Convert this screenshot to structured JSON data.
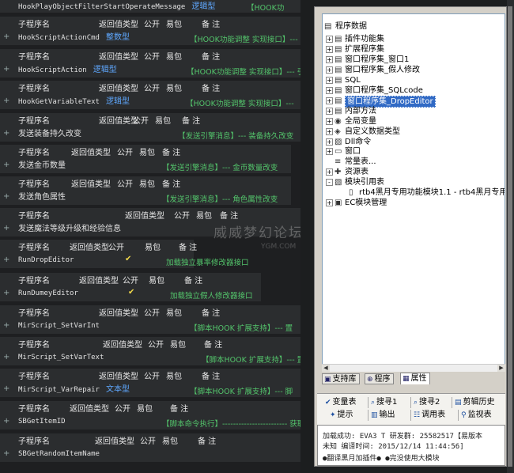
{
  "header_labels": [
    "子程序名",
    "返回值类型",
    "公开",
    "易包",
    "备 注"
  ],
  "top_line": {
    "name": "HookPlayObjectFilterStartOperateMessage",
    "type": "逻辑型",
    "comment": "【HOOK功"
  },
  "cards": [
    {
      "name": "HookScriptActionCmd",
      "type": "整数型",
      "check": "",
      "comment": "【HOOK功能调整 实现接口】---"
    },
    {
      "name": "HookScriptAction",
      "type": "逻辑型",
      "check": "",
      "comment": "【HOOK功能调整 实现接口】--- 引"
    },
    {
      "name": "HookGetVariableText",
      "type": "逻辑型",
      "check": "",
      "comment": "【HOOK功能调整 实现接口】---"
    },
    {
      "name": "发送装备持久改变",
      "type": "",
      "check": "",
      "comment": "【发送引擎消息】--- 装备持久改变"
    },
    {
      "name": "发送金币数量",
      "type": "",
      "check": "",
      "comment": "【发送引擎消息】--- 金币数量改变"
    },
    {
      "name": "发送角色属性",
      "type": "",
      "check": "",
      "comment": "【发送引擎消息】--- 角色属性改变"
    },
    {
      "name": "发送魔法等级升级和经验信息",
      "type": "",
      "check": "",
      "comment": ""
    },
    {
      "name": "RunDropEditor",
      "type": "",
      "check": "✔",
      "comment": "加载独立暴率修改器接口"
    },
    {
      "name": "RunDumeyEditor",
      "type": "",
      "check": "✔",
      "comment": "加载独立假人修改器接口"
    },
    {
      "name": "MirScript_SetVarInt",
      "type": "",
      "check": "",
      "comment": "【脚本HOOK 扩展支持】--- 置"
    },
    {
      "name": "MirScript_SetVarText",
      "type": "",
      "check": "",
      "comment": "【脚本HOOK 扩展支持】--- 置"
    },
    {
      "name": "MirScript_VarRepair",
      "type": "文本型",
      "check": "",
      "comment": "【脚本HOOK 扩展支持】--- 脚"
    },
    {
      "name": "SBGetItemID",
      "type": "",
      "check": "",
      "comment": "【脚本命令执行】------------------------ 获取"
    },
    {
      "name": "SBGetRandomItemName",
      "type": "",
      "check": "",
      "comment": ""
    }
  ],
  "watermark": {
    "main": "威威梦幻论坛",
    "sub": "YGM.COM"
  },
  "tree": {
    "root": "程序数据",
    "items": [
      {
        "label": "插件功能集",
        "icon": "stack-icon",
        "expander": "+"
      },
      {
        "label": "扩展程序集",
        "icon": "stack-icon",
        "expander": "+"
      },
      {
        "label": "窗口程序集_窗口1",
        "icon": "stack-icon",
        "expander": "+"
      },
      {
        "label": "窗口程序集_假人修改",
        "icon": "stack-icon",
        "expander": "+"
      },
      {
        "label": "SQL",
        "icon": "stack-icon",
        "expander": "+"
      },
      {
        "label": "窗口程序集_SQLcode",
        "icon": "stack-icon",
        "expander": "+"
      },
      {
        "label": "窗口程序集_DropEditor",
        "icon": "stack-icon",
        "expander": "+",
        "selected": true
      },
      {
        "label": "内部方法",
        "icon": "stack-icon",
        "expander": "+"
      },
      {
        "label": "全局变量",
        "icon": "globe-icon",
        "expander": "+"
      },
      {
        "label": "自定义数据类型",
        "icon": "type-icon",
        "expander": "+"
      },
      {
        "label": "Dll命令",
        "icon": "dll-icon",
        "expander": "+"
      },
      {
        "label": "窗口",
        "icon": "window-icon",
        "expander": "+"
      },
      {
        "label": "常量表...",
        "icon": "const-icon",
        "expander": ""
      },
      {
        "label": "资源表",
        "icon": "resource-icon",
        "expander": "+"
      },
      {
        "label": "模块引用表",
        "icon": "module-icon",
        "expander": "-"
      },
      {
        "label": "rtb4黑月专用功能模块1.1 - rtb4黑月专用",
        "icon": "module-file-icon",
        "expander": "",
        "child": true
      },
      {
        "label": "EC模块管理",
        "icon": "ec-icon",
        "expander": "+"
      }
    ]
  },
  "bottom_tabs": [
    {
      "label": "支持库",
      "icon": "library-icon"
    },
    {
      "label": "程序",
      "icon": "program-icon"
    },
    {
      "label": "属性",
      "icon": "property-icon",
      "active": true
    }
  ],
  "tools": [
    {
      "label": "变量表",
      "icon": "variable-icon"
    },
    {
      "label": "搜寻1",
      "icon": "search-icon"
    },
    {
      "label": "搜寻2",
      "icon": "search-icon"
    },
    {
      "label": "剪辑历史",
      "icon": "clipboard-icon"
    },
    {
      "label": "提示",
      "icon": "hint-icon"
    },
    {
      "label": "输出",
      "icon": "output-icon"
    },
    {
      "label": "调用表",
      "icon": "call-icon"
    },
    {
      "label": "监视表",
      "icon": "watch-icon"
    }
  ],
  "output": {
    "line1": "加载成功: EVA3 T 研发群: 25582517【易版本",
    "line2": "未知 编译时间: 2015/12/14 11:44:56]",
    "line3": "●翻译黑月加插件●   ●完没使用大模块"
  }
}
